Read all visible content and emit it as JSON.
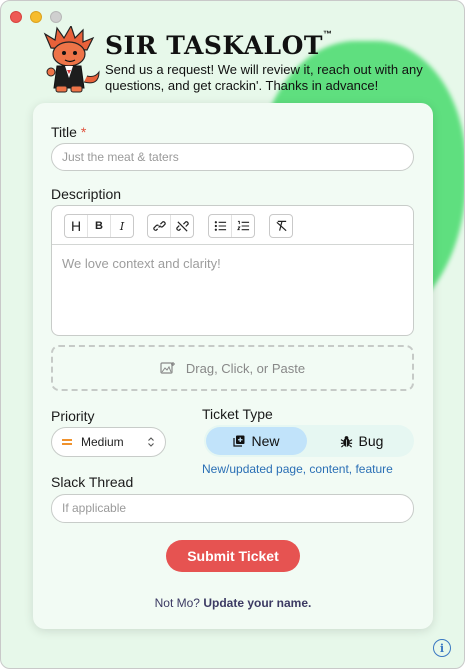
{
  "app": {
    "brand": "SIR TASKALOT",
    "trademark": "™",
    "tagline": "Send us a request! We will review it, reach out with any questions, and get crackin'. Thanks in advance!"
  },
  "form": {
    "title_label": "Title",
    "required_mark": "*",
    "title_placeholder": "Just the meat & taters",
    "description_label": "Description",
    "description_placeholder": "We love context and clarity!",
    "toolbar": {
      "heading": "H",
      "bold": "B",
      "italic": "I"
    },
    "dropzone_label": "Drag, Click, or Paste",
    "priority_label": "Priority",
    "priority_value": "Medium",
    "ticket_type_label": "Ticket Type",
    "ticket_types": [
      {
        "label": "New",
        "icon": "plus-square-icon",
        "selected": true
      },
      {
        "label": "Bug",
        "icon": "bug-icon",
        "selected": false
      }
    ],
    "ticket_type_description": "New/updated page, content, feature",
    "slack_label": "Slack Thread",
    "slack_placeholder": "If applicable",
    "submit_label": "Submit Ticket"
  },
  "footer": {
    "prefix": "Not Mo?",
    "link": "Update your name."
  },
  "info_icon": "i",
  "colors": {
    "background": "#e7f8ea",
    "accent_blob": "#5fdf7f",
    "submit": "#e65351",
    "selected_segment": "#c1e3fa",
    "link": "#2a6fb5",
    "required": "#e0523e"
  }
}
